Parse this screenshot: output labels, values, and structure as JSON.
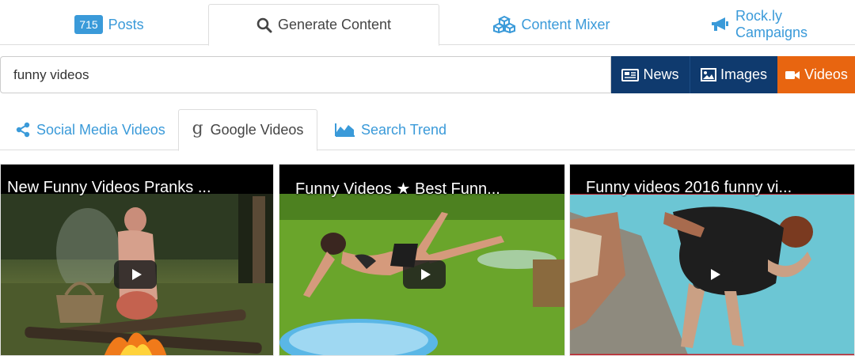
{
  "top_tabs": [
    {
      "badge": "715",
      "label": "Posts",
      "icon": "badge"
    },
    {
      "label": "Generate Content",
      "icon": "search-icon"
    },
    {
      "label": "Content Mixer",
      "icon": "cubes-icon"
    },
    {
      "label": "Rock.ly Campaigns",
      "icon": "bullhorn-icon"
    }
  ],
  "search": {
    "value": "funny videos"
  },
  "type_buttons": [
    {
      "label": "News",
      "icon": "newspaper-icon"
    },
    {
      "label": "Images",
      "icon": "image-icon"
    },
    {
      "label": "Videos",
      "icon": "video-camera-icon"
    }
  ],
  "sub_tabs": [
    {
      "label": "Social Media Videos",
      "icon": "share-icon"
    },
    {
      "label": "Google Videos",
      "icon": "google-g-icon"
    },
    {
      "label": "Search Trend",
      "icon": "area-chart-icon"
    }
  ],
  "videos": [
    {
      "title": "New Funny Videos Pranks ..."
    },
    {
      "title": "Funny Videos ★ Best Funn..."
    },
    {
      "title": "Funny videos 2016 funny vi..."
    }
  ],
  "colors": {
    "accent": "#3a9ad9",
    "navy": "#0f3a6e",
    "orange": "#e86510"
  }
}
